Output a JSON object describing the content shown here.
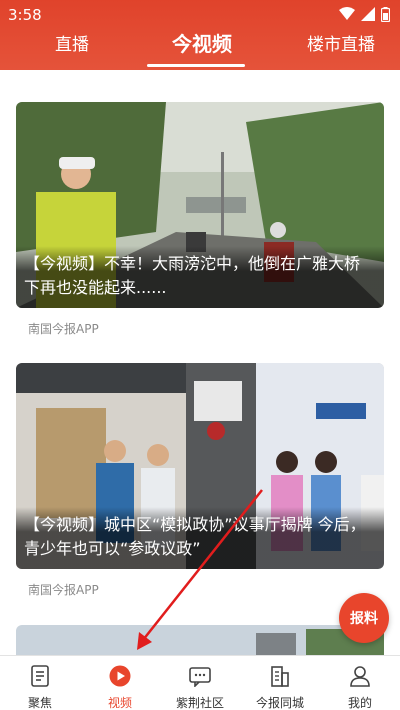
{
  "status": {
    "time": "3:58"
  },
  "tabs": {
    "live": "直播",
    "video": "今视频",
    "property_live": "楼市直播"
  },
  "articles": [
    {
      "title": "【今视频】不幸！大雨滂沱中，他倒在广雅大桥下再也没能起来......",
      "source": "南国今报APP"
    },
    {
      "title": "【今视频】城中区“模拟政协”议事厅揭牌 今后，青少年也可以“参政议政”",
      "source": "南国今报APP"
    }
  ],
  "report_button": "报料",
  "nav": {
    "items": [
      {
        "label": "聚焦",
        "icon": "document-icon"
      },
      {
        "label": "视频",
        "icon": "play-icon"
      },
      {
        "label": "紫荆社区",
        "icon": "chat-icon"
      },
      {
        "label": "今报同城",
        "icon": "building-icon"
      },
      {
        "label": "我的",
        "icon": "person-icon"
      }
    ],
    "active": "视频"
  },
  "colors": {
    "accent": "#e8452c",
    "topbar": "#e0432b"
  }
}
